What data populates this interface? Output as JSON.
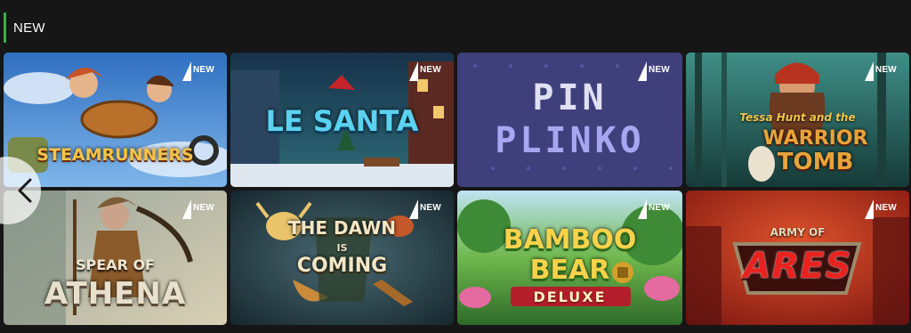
{
  "section": {
    "title": "NEW"
  },
  "badge_label": "NEW",
  "games": [
    {
      "id": "steamrunners",
      "title": "STEAMRUNNERS",
      "colors": [
        "#3f7fc8",
        "#6aa4e0"
      ]
    },
    {
      "id": "le-santa",
      "title": "LE SANTA",
      "colors": [
        "#1c3a4f",
        "#2c6273"
      ]
    },
    {
      "id": "pin-plinko",
      "title_line1": "PIN",
      "title_line2": "PLINKO",
      "colors": [
        "#3e3e7a",
        "#4c4a8c"
      ]
    },
    {
      "id": "tessa-hunt",
      "title_small": "Tessa Hunt and the",
      "title_line1": "WARRIOR",
      "title_line2": "TOMB",
      "colors": [
        "#1e4d4a",
        "#3b7a6b"
      ]
    },
    {
      "id": "spear-of-athena",
      "title_small": "SPEAR OF",
      "title_line1": "ATHENA",
      "colors": [
        "#6f7a70",
        "#c9c2a8"
      ]
    },
    {
      "id": "dawn-is-coming",
      "title_line1": "THE DAWN",
      "title_small": "IS",
      "title_line2": "COMING",
      "colors": [
        "#263c4a",
        "#3b5a63"
      ]
    },
    {
      "id": "bamboo-bear",
      "title_line1": "BAMBOO",
      "title_line2": "BEAR",
      "title_small": "DELUXE",
      "colors": [
        "#2b7a3e",
        "#6eb54a"
      ]
    },
    {
      "id": "army-of-ares",
      "title_small": "ARMY OF",
      "title_line1": "ARES",
      "colors": [
        "#9c1e1a",
        "#d9442a"
      ]
    }
  ],
  "nav": {
    "prev_icon": "chevron-left-icon"
  }
}
